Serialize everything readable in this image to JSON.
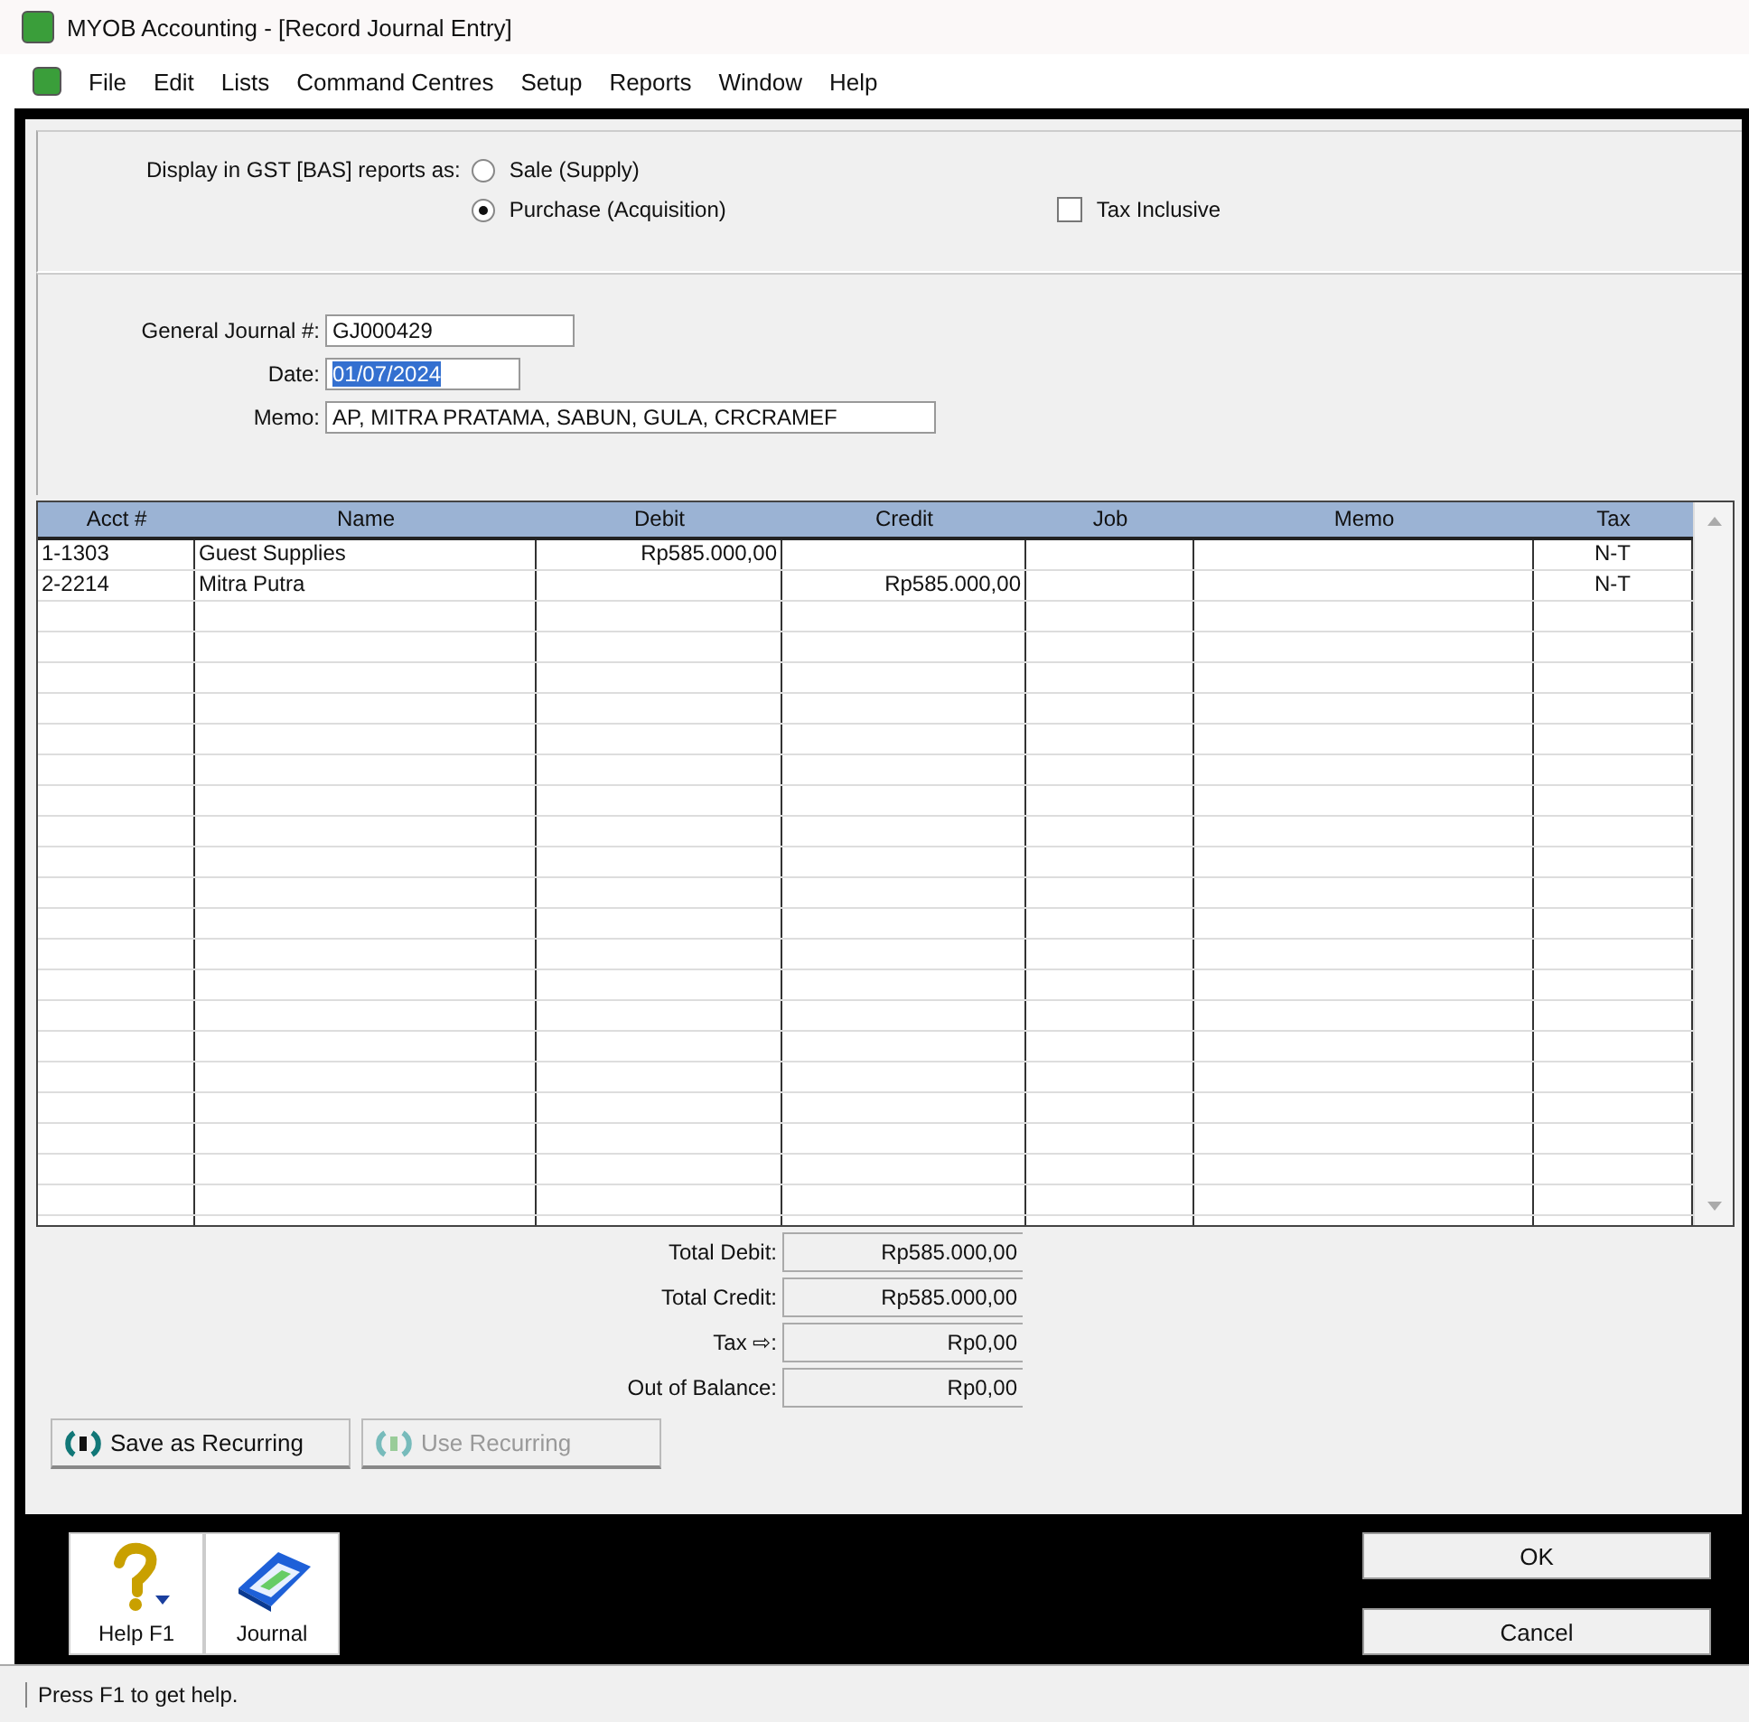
{
  "window": {
    "title": "MYOB Accounting - [Record Journal Entry]"
  },
  "menu": [
    "File",
    "Edit",
    "Lists",
    "Command Centres",
    "Setup",
    "Reports",
    "Window",
    "Help"
  ],
  "gst": {
    "label": "Display in GST [BAS] reports as:",
    "options": [
      {
        "label": "Sale (Supply)",
        "selected": false
      },
      {
        "label": "Purchase (Acquisition)",
        "selected": true
      }
    ],
    "tax_inclusive": {
      "label": "Tax Inclusive",
      "checked": false
    }
  },
  "fields": [
    {
      "label": "General Journal #:",
      "value": "GJ000429",
      "highlighted": false
    },
    {
      "label": "Date:",
      "value": "01/07/2024",
      "highlighted": true
    },
    {
      "label": "Memo:",
      "value": "AP, MITRA PRATAMA, SABUN, GULA, CRCRAMEF",
      "highlighted": false
    }
  ],
  "table": {
    "columns": [
      "Acct #",
      "Name",
      "Debit",
      "Credit",
      "Job",
      "Memo",
      "Tax"
    ],
    "rows": [
      [
        "1-1303",
        "Guest Supplies",
        "Rp585.000,00",
        "",
        "",
        "",
        "N-T"
      ],
      [
        "2-2214",
        "Mitra Putra",
        "",
        "Rp585.000,00",
        "",
        "",
        "N-T"
      ]
    ]
  },
  "totals": [
    {
      "label": "Total Debit:",
      "value": "Rp585.000,00"
    },
    {
      "label": "Total Credit:",
      "value": "Rp585.000,00"
    },
    {
      "label": "Tax ⇨:",
      "value": "Rp0,00"
    },
    {
      "label": "Out of Balance:",
      "value": "Rp0,00"
    }
  ],
  "recurring_buttons": [
    {
      "label": "Save as Recurring",
      "disabled": false
    },
    {
      "label": "Use Recurring",
      "disabled": true
    }
  ],
  "toolbar": [
    {
      "label": "Help F1",
      "kind": "help"
    },
    {
      "label": "Journal",
      "kind": "journal"
    }
  ],
  "buttons": [
    "OK",
    "Cancel"
  ],
  "status_bar": "Press F1 to get help."
}
